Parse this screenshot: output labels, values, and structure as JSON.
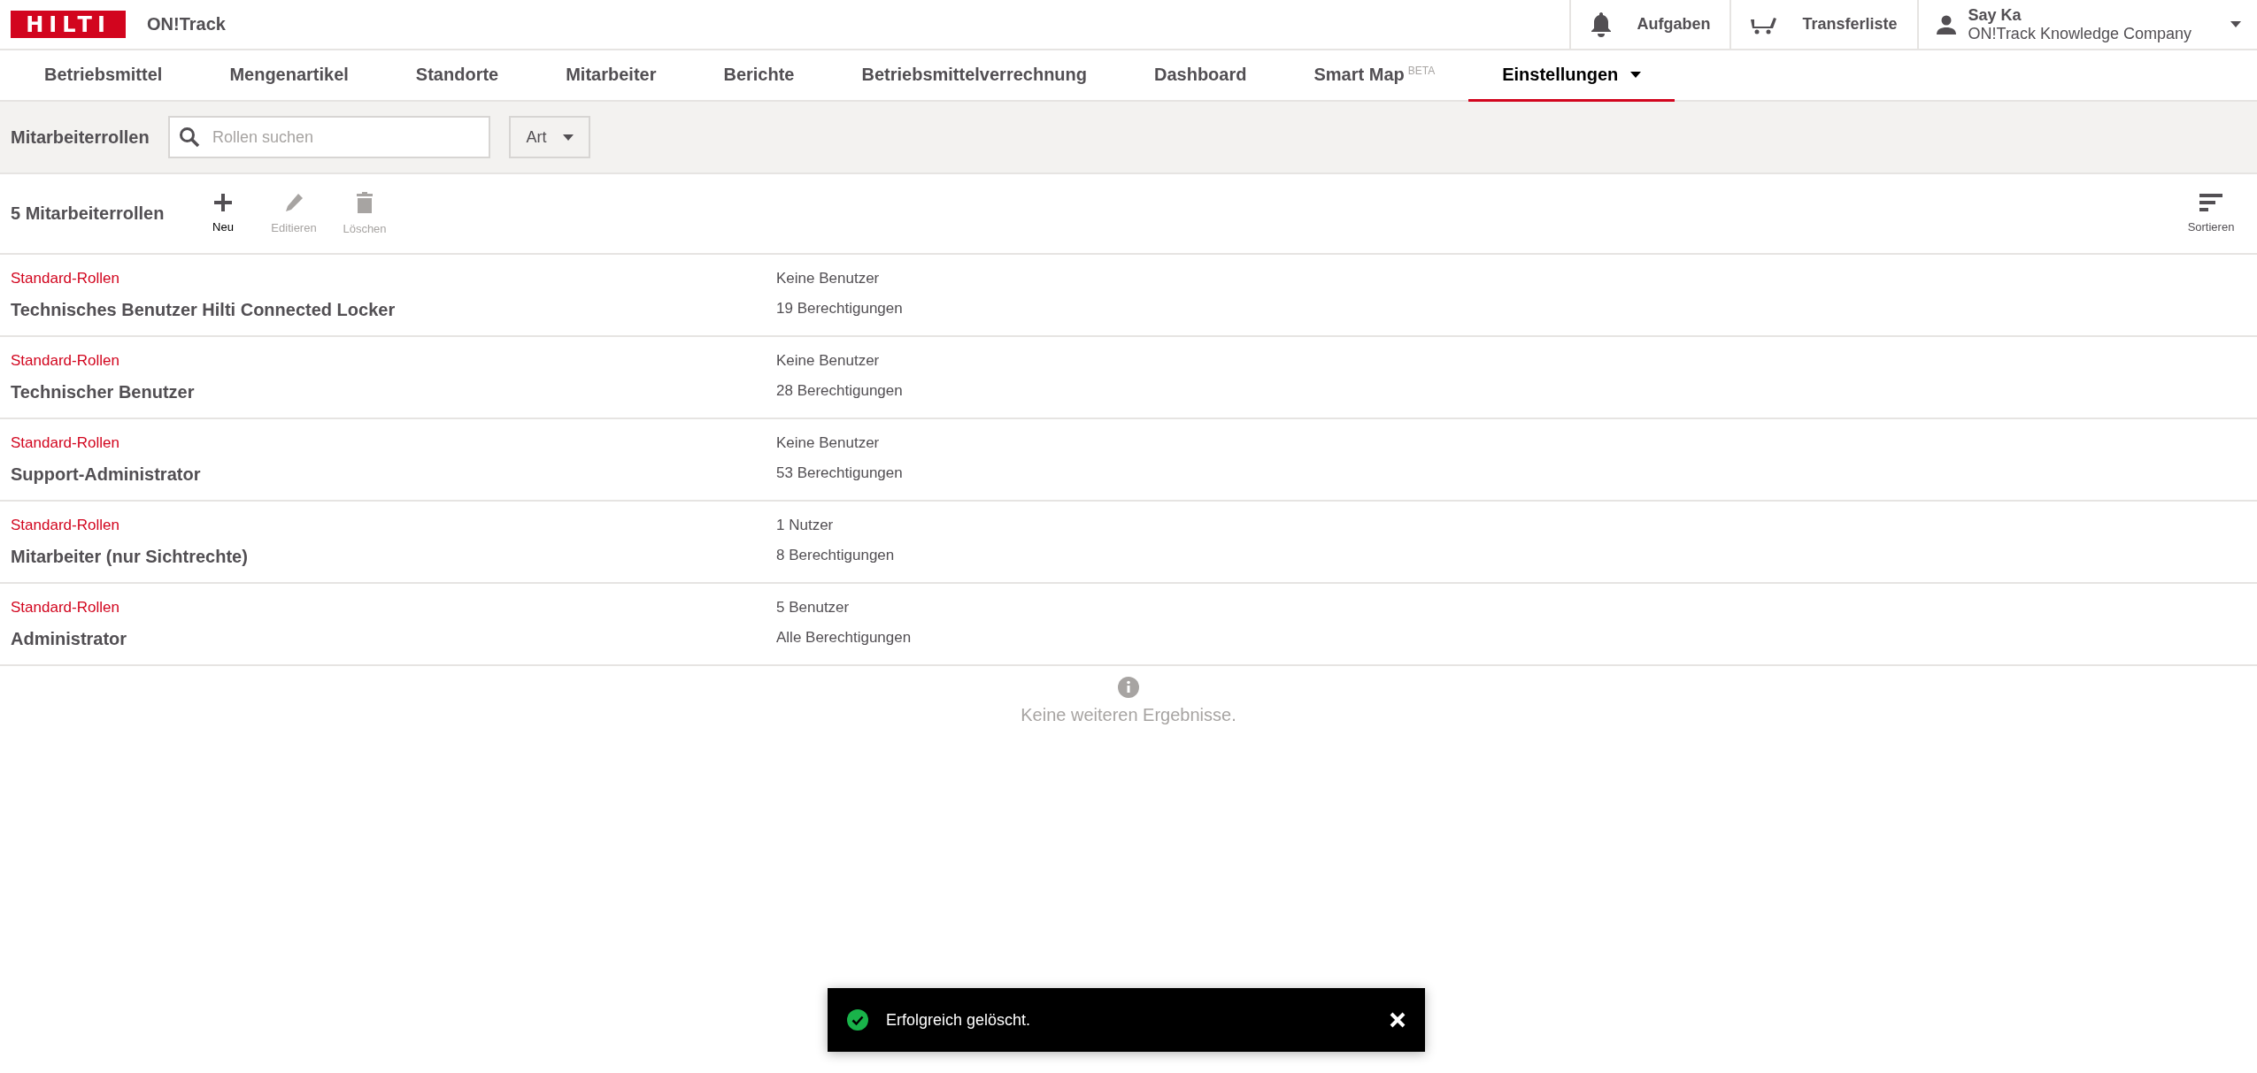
{
  "header": {
    "logo": "HILTI",
    "app_name": "ON!Track",
    "actions": [
      {
        "kind": "bell",
        "label": "Aufgaben"
      },
      {
        "kind": "cart",
        "label": "Transferliste"
      }
    ],
    "user": {
      "name": "Say Ka",
      "company": "ON!Track Knowledge Company"
    }
  },
  "nav": [
    {
      "label": "Betriebsmittel",
      "selected": false
    },
    {
      "label": "Mengenartikel",
      "selected": false
    },
    {
      "label": "Standorte",
      "selected": false
    },
    {
      "label": "Mitarbeiter",
      "selected": false
    },
    {
      "label": "Berichte",
      "selected": false
    },
    {
      "label": "Betriebsmittelverrechnung",
      "selected": false
    },
    {
      "label": "Dashboard",
      "selected": false
    },
    {
      "label": "Smart Map",
      "badge": "BETA",
      "selected": false
    },
    {
      "label": "Einstellungen",
      "dropdown": true,
      "selected": true
    }
  ],
  "filter_bar": {
    "title": "Mitarbeiterrollen",
    "search": {
      "placeholder": "Rollen suchen"
    },
    "filter": "Art"
  },
  "toolbar": {
    "count": "5 Mitarbeiterrollen",
    "buttons": [
      {
        "kind": "add",
        "label": "Neu",
        "disabled": false
      },
      {
        "kind": "edit",
        "label": "Editieren",
        "disabled": true
      },
      {
        "kind": "delete",
        "label": "Löschen",
        "disabled": true
      }
    ],
    "sort": "Sortieren"
  },
  "rows": [
    {
      "category": "Standard-Rollen",
      "name": "Technisches Benutzer Hilti Connected Locker",
      "users": "Keine Benutzer",
      "permissions": "19 Berechtigungen"
    },
    {
      "category": "Standard-Rollen",
      "name": "Technischer Benutzer",
      "users": "Keine Benutzer",
      "permissions": "28 Berechtigungen"
    },
    {
      "category": "Standard-Rollen",
      "name": "Support-Administrator",
      "users": "Keine Benutzer",
      "permissions": "53 Berechtigungen"
    },
    {
      "category": "Standard-Rollen",
      "name": "Mitarbeiter (nur Sichtrechte)",
      "users": "1 Nutzer",
      "permissions": "8 Berechtigungen"
    },
    {
      "category": "Standard-Rollen",
      "name": "Administrator",
      "users": "5 Benutzer",
      "permissions": "Alle Berechtigungen"
    }
  ],
  "end_message": "Keine weiteren Ergebnisse.",
  "toast": {
    "message": "Erfolgreich gelöscht."
  }
}
